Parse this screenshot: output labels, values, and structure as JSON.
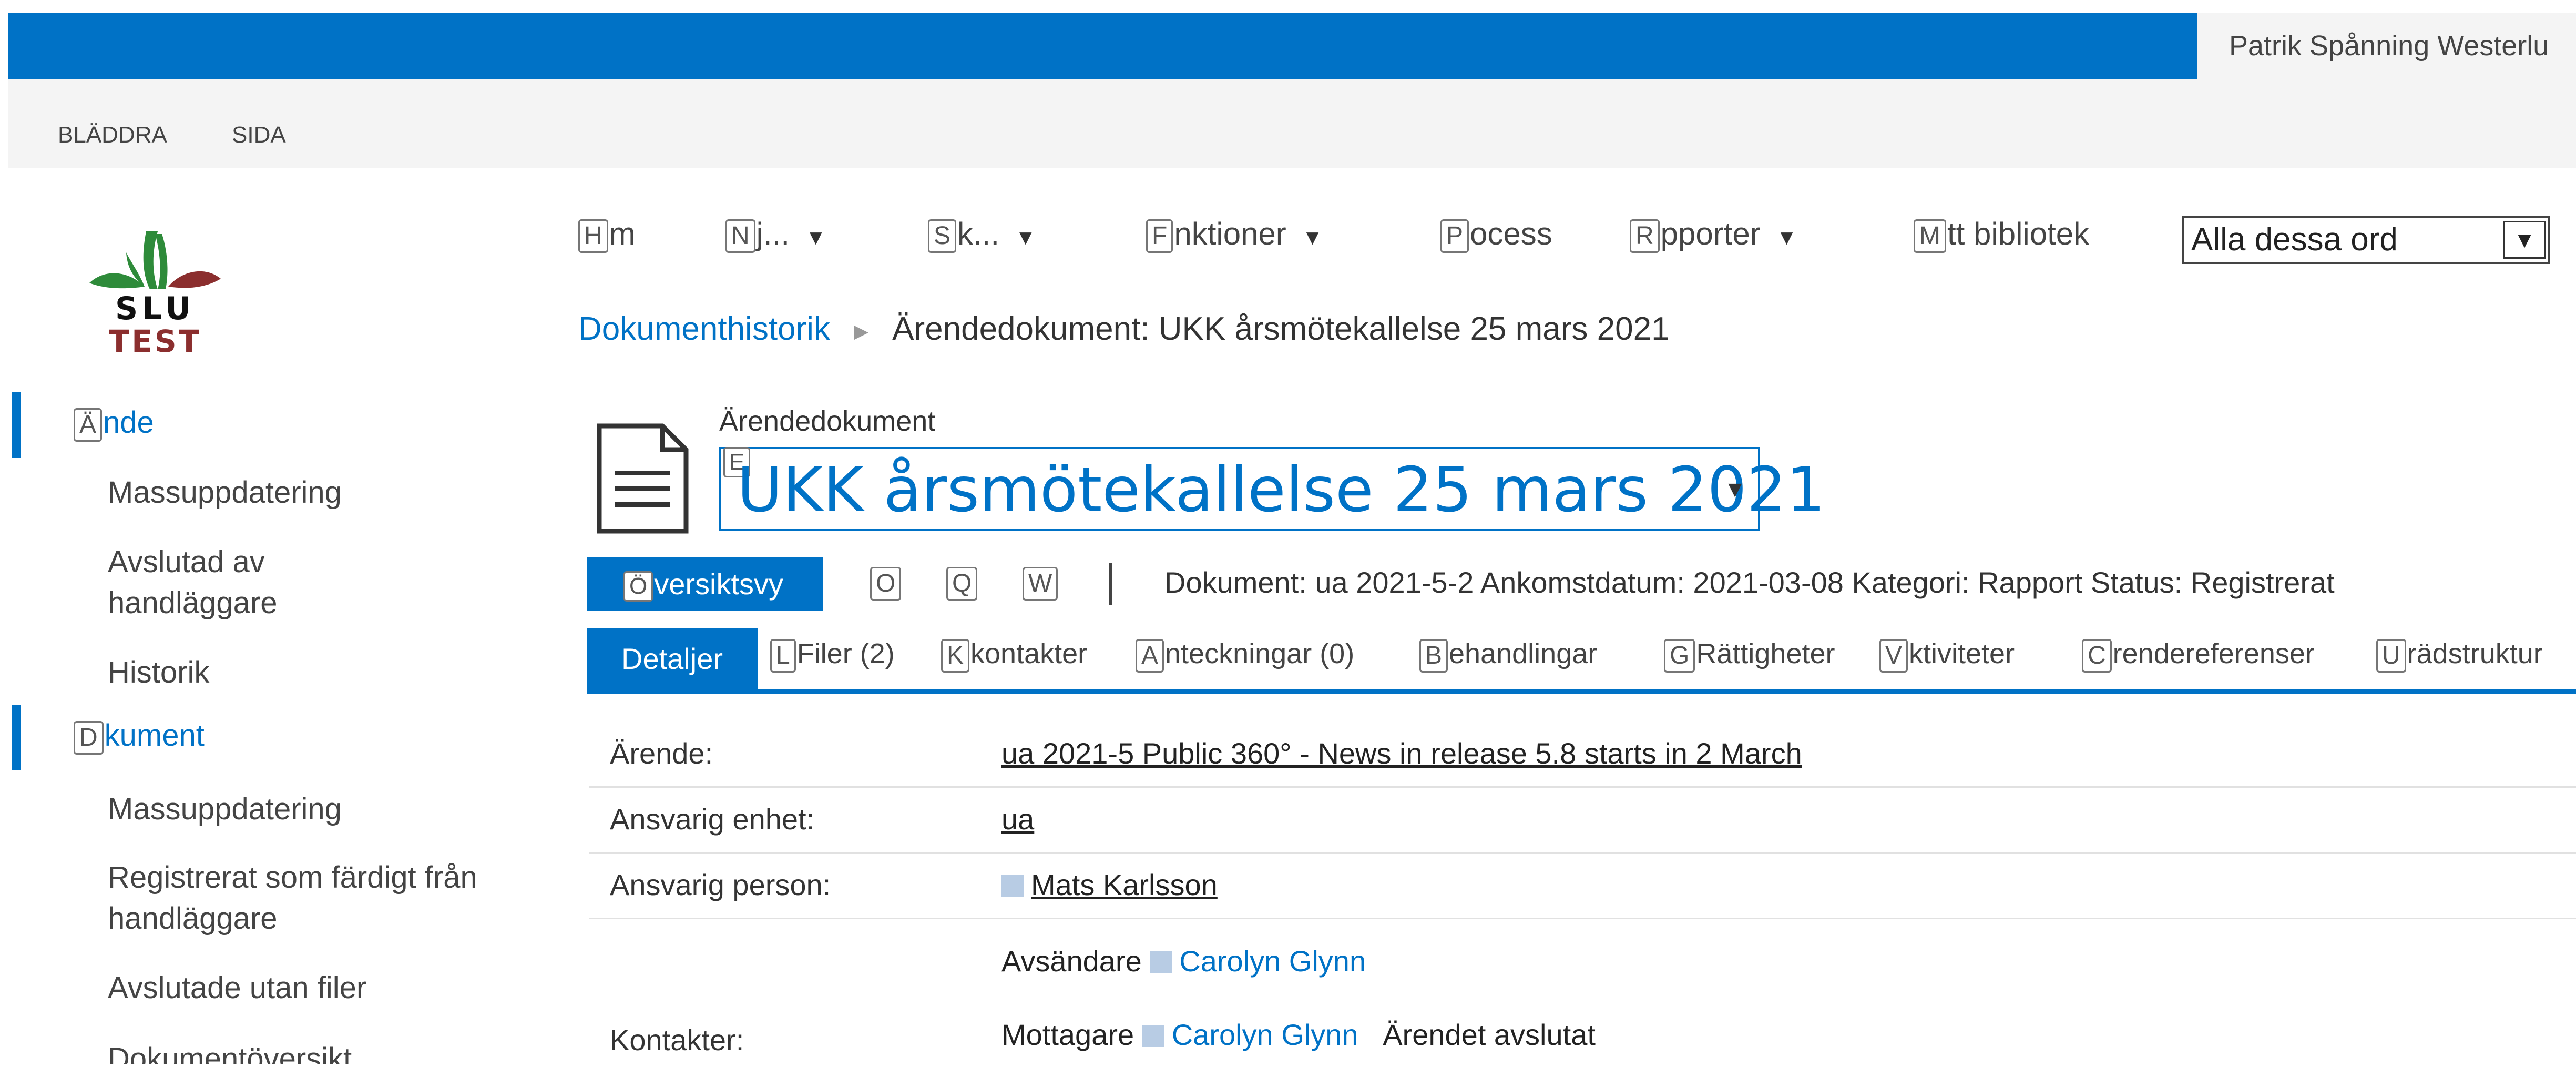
{
  "suite_bar": {
    "user_name": "Patrik Spånning Westerlu"
  },
  "ribbon": {
    "tabs": [
      "BLÄDDRA",
      "SIDA"
    ]
  },
  "logo": {
    "line1": "SLU",
    "line2": "TEST"
  },
  "top_nav": {
    "items": [
      {
        "key": "H",
        "label": "m",
        "has_menu": false
      },
      {
        "key": "N",
        "label": "j...",
        "has_menu": true
      },
      {
        "key": "S",
        "label": "k...",
        "has_menu": true
      },
      {
        "key": "F",
        "label": "nktioner",
        "has_menu": true
      },
      {
        "key": "P",
        "label": "ocess",
        "has_menu": false
      },
      {
        "key": "R",
        "label": "pporter",
        "has_menu": true
      },
      {
        "key": "M",
        "label": "tt bibliotek",
        "has_menu": false
      }
    ],
    "search_scope": "Alla dessa ord"
  },
  "breadcrumb": {
    "link": "Dokumenthistorik",
    "current": "Ärendedokument: UKK årsmötekallelse 25 mars 2021"
  },
  "quick_launch": {
    "sections": [
      {
        "key": "Ä",
        "label": "nde",
        "items": [
          "Massuppdatering",
          "Avslutad av handläggare",
          "Historik"
        ]
      },
      {
        "key": "D",
        "label": "kument",
        "items": [
          "Massuppdatering",
          "Registrerat som färdigt från handläggare",
          "Avslutade utan filer",
          "Dokumentöversikt"
        ]
      }
    ]
  },
  "document": {
    "type": "Ärendedokument",
    "title_key": "E",
    "title": "UKK årsmötekallelse 25 mars 2021",
    "overview_key": "Ö",
    "overview_label": "versiktsvy",
    "icon_keys": [
      "O",
      "Q",
      "W"
    ],
    "meta": "Dokument: ua 2021-5-2   Ankomstdatum: 2021-03-08   Kategori: Rapport   Status: Registrerat"
  },
  "tabs": [
    {
      "key": "",
      "label": "Detaljer"
    },
    {
      "key": "L",
      "label": "Filer (2)"
    },
    {
      "key": "K",
      "label": "kontakter"
    },
    {
      "key": "A",
      "label": "nteckningar (0)"
    },
    {
      "key": "B",
      "label": "ehandlingar"
    },
    {
      "key": "G",
      "label": "Rättigheter"
    },
    {
      "key": "V",
      "label": "ktiviteter"
    },
    {
      "key": "C",
      "label": "rendereferenser"
    },
    {
      "key": "U",
      "label": "rädstruktur"
    }
  ],
  "details": {
    "arende_label": "Ärende:",
    "arende_value": "ua 2021-5 Public 360° - News in release 5.8 starts in 2 March",
    "enhet_label": "Ansvarig enhet:",
    "enhet_value": "ua",
    "person_label": "Ansvarig person:",
    "person_value": "Mats Karlsson",
    "kontakter_label": "Kontakter:",
    "sender_role": "Avsändare",
    "sender_name": "Carolyn Glynn",
    "receiver_role": "Mottagare",
    "receiver_name": "Carolyn Glynn",
    "receiver_note": "Ärendet avslutat"
  }
}
